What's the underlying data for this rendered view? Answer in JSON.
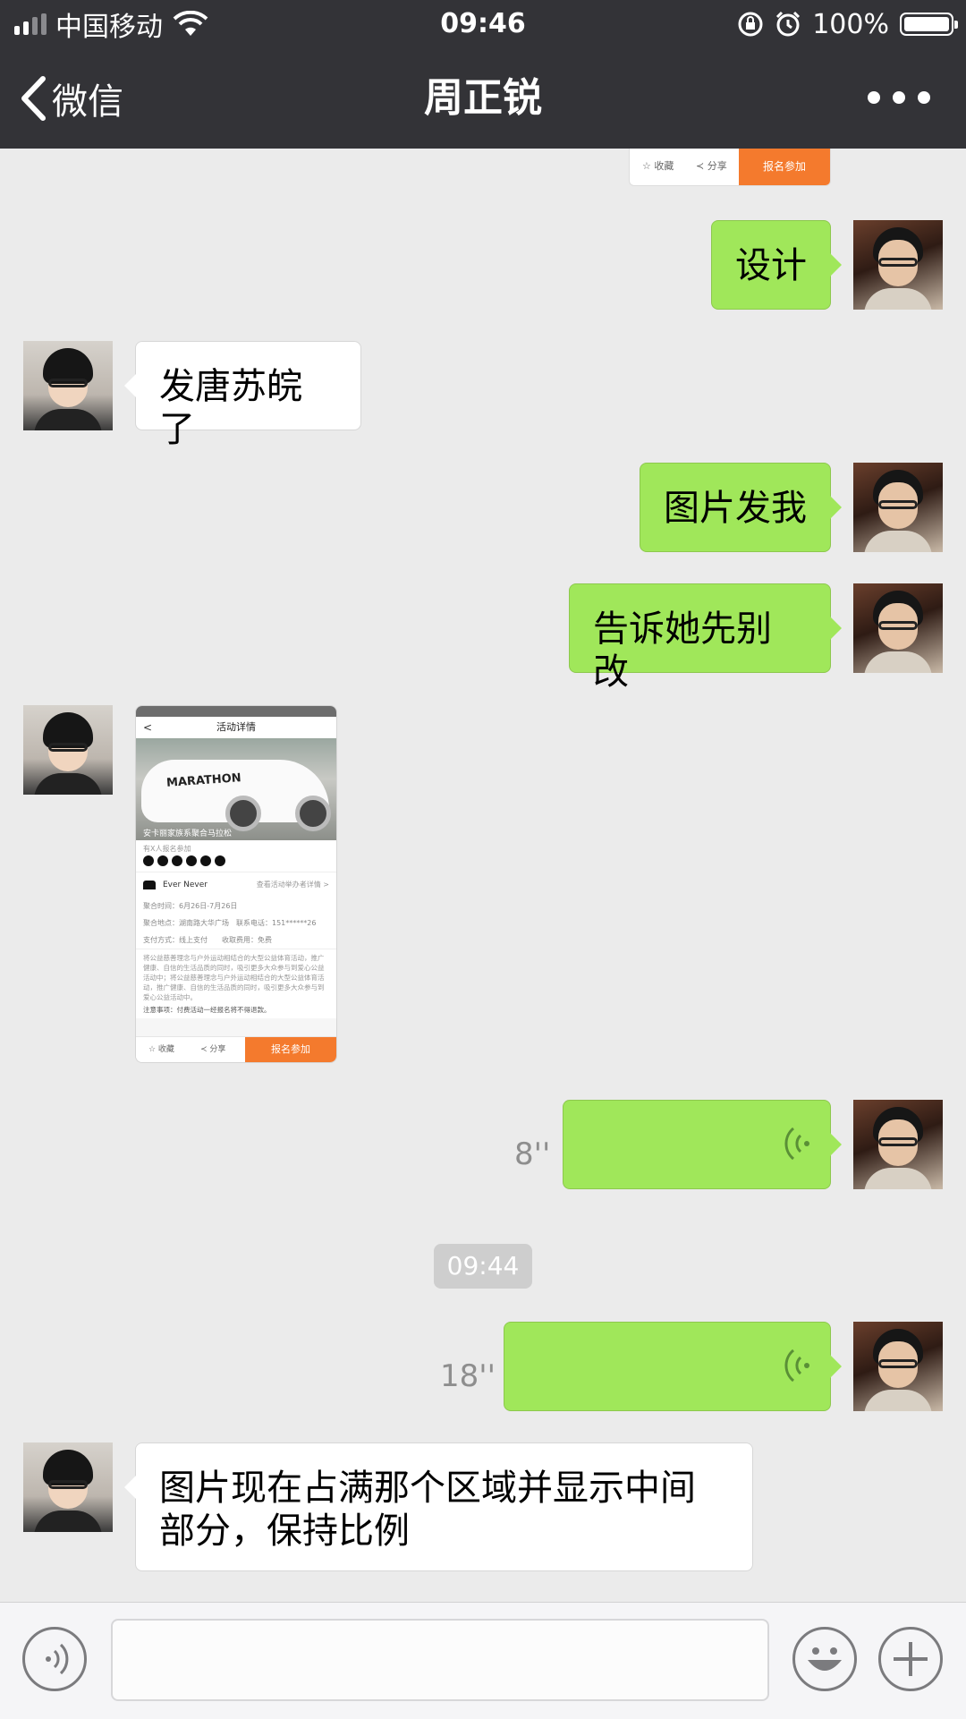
{
  "status_bar": {
    "carrier": "中国移动",
    "time": "09:46",
    "battery": "100%"
  },
  "nav": {
    "back_label": "微信",
    "title": "周正锐"
  },
  "shared_card": {
    "favorite": "☆ 收藏",
    "share": "≺ 分享",
    "signup": "报名参加"
  },
  "messages": {
    "m1": "设计",
    "m2": "发唐苏皖了",
    "m3": "图片发我",
    "m4": "告诉她先别改",
    "voice1_len": "8''",
    "timestamp": "09:44",
    "voice2_len": "18''",
    "m5": "图片现在占满那个区域并显示中间部分，保持比例"
  },
  "image_message": {
    "header": "活动详情",
    "car_text": "MARATHON",
    "photo_caption": "安卡丽家族系聚合马拉松",
    "registered_label": "有X人报名参加",
    "organizer": "Ever Never",
    "organizer_link": "查看活动举办者详情 >",
    "time_row": "聚合时间：6月26日-7月26日",
    "place_row": "聚合地点：湖南路大华广场　联系电话：151******26",
    "pay_row": "支付方式：线上支付　　收取费用：免费",
    "description": "将公益慈善理念与户外运动相结合的大型公益体育活动，推广健康、自信的生活品质的同时，吸引更多大众参与到爱心公益活动中；将公益慈善理念与户外运动相结合的大型公益体育活动，推广健康、自信的生活品质的同时，吸引更多大众参与到爱心公益活动中。",
    "notice": "注意事项：付费活动一经报名将不得退款。",
    "favorite": "☆ 收藏",
    "share": "≺ 分享",
    "signup": "报名参加"
  },
  "colors": {
    "sent_bubble": "#a0e75a",
    "received_bubble": "#ffffff",
    "bar": "#333337",
    "accent_orange": "#f47a2d"
  },
  "icons": [
    "signal-icon",
    "wifi-icon",
    "orientation-lock-icon",
    "alarm-icon",
    "battery-icon",
    "chevron-left-icon",
    "more-icon",
    "voice-wave-icon",
    "voice-input-icon",
    "emoji-icon",
    "plus-icon"
  ]
}
